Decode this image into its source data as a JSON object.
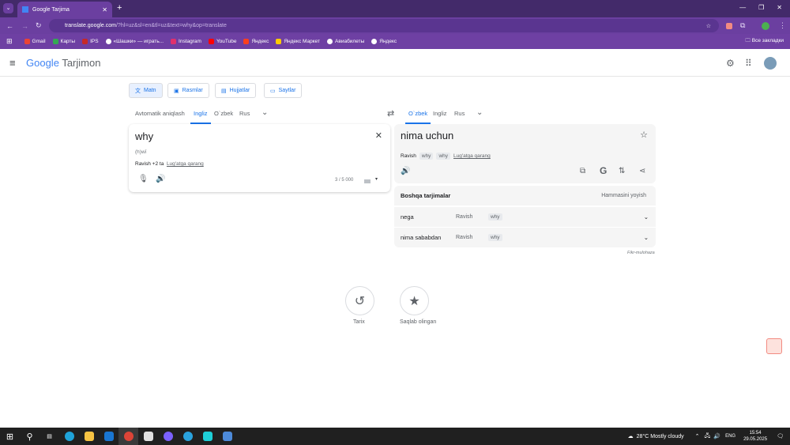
{
  "browser": {
    "tab_title": "Google Tarjima",
    "url_host": "translate.google.com",
    "url_rest": "/?hl=uz&sl=en&tl=uz&text=why&op=translate",
    "bookmarks": [
      "Gmail",
      "Карты",
      "IPS",
      "«Шашки» — играть...",
      "Instagram",
      "YouTube",
      "Яндекс",
      "Яндекс Маркет",
      "Авиабилеты",
      "Яндекс"
    ],
    "all_bookmarks": "Все закладки"
  },
  "app": {
    "logo_google": "Google",
    "logo_name": "Tarjimon"
  },
  "modes": [
    "Matn",
    "Rasmlar",
    "Hujjatlar",
    "Saytlar"
  ],
  "source": {
    "langs": [
      "Avtomatik aniqlash",
      "Ingliz",
      "O`zbek",
      "Rus"
    ],
    "text": "why",
    "transliteration": "(h)wī",
    "pos": "Ravish +2 ta",
    "dict_link": "Lug'atga qarang",
    "count": "3 / 5 000"
  },
  "target": {
    "langs": [
      "O`zbek",
      "Ingliz",
      "Rus"
    ],
    "text": "nima uchun",
    "pos": "Ravish",
    "chips": [
      "why",
      "why"
    ],
    "dict_link": "Lug'atga qarang"
  },
  "other": {
    "title": "Boshqa tarjimalar",
    "expand": "Hammasini yoyish",
    "rows": [
      {
        "word": "nega",
        "pos": "Ravish",
        "chip": "why"
      },
      {
        "word": "nima sababdan",
        "pos": "Ravish",
        "chip": "why"
      }
    ],
    "feedback": "Fikr-mulohaza"
  },
  "history": {
    "label": "Tarix"
  },
  "saved": {
    "label": "Saqlab olingan"
  },
  "taskbar": {
    "weather": "28°C  Mostly cloudy",
    "lang": "ENG",
    "time": "15:54",
    "date": "29.05.2025"
  }
}
